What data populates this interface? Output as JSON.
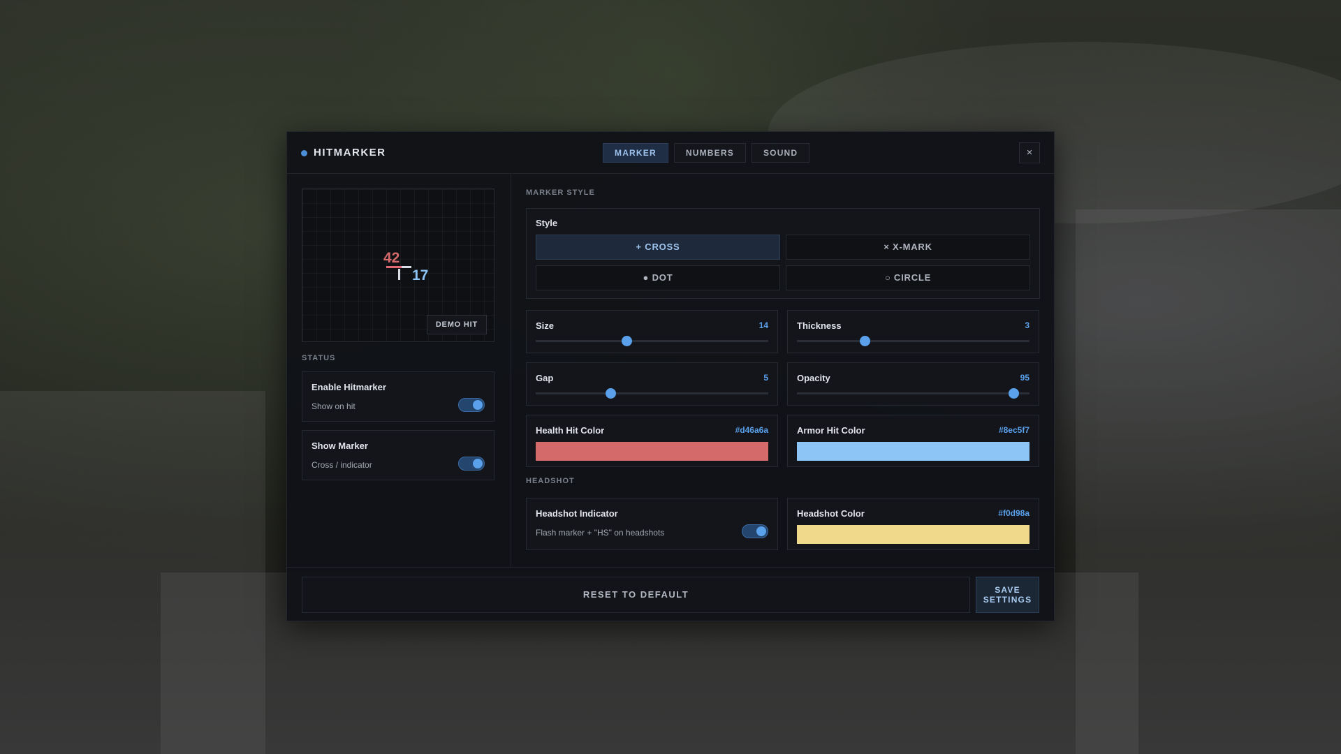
{
  "header": {
    "title": "HITMARKER",
    "tabs": [
      {
        "label": "MARKER",
        "active": true
      },
      {
        "label": "NUMBERS",
        "active": false
      },
      {
        "label": "SOUND",
        "active": false
      }
    ],
    "close_glyph": "×"
  },
  "preview": {
    "health_number": "42",
    "armor_number": "17",
    "demo_label": "DEMO HIT"
  },
  "status": {
    "label": "STATUS",
    "enable_hitmarker": {
      "title": "Enable Hitmarker",
      "subtitle": "Show on hit",
      "enabled": true
    },
    "show_marker": {
      "title": "Show Marker",
      "subtitle": "Cross / indicator",
      "enabled": true
    }
  },
  "marker_style": {
    "section_label": "MARKER STYLE",
    "style_title": "Style",
    "options": [
      {
        "label": "+ CROSS",
        "selected": true
      },
      {
        "label": "× X-MARK",
        "selected": false
      },
      {
        "label": "● DOT",
        "selected": false
      },
      {
        "label": "○ CIRCLE",
        "selected": false
      }
    ]
  },
  "sliders": {
    "size": {
      "label": "Size",
      "value": "14",
      "fraction": 0.39
    },
    "thickness": {
      "label": "Thickness",
      "value": "3",
      "fraction": 0.29
    },
    "gap": {
      "label": "Gap",
      "value": "5",
      "fraction": 0.32
    },
    "opacity": {
      "label": "Opacity",
      "value": "95",
      "fraction": 0.93
    }
  },
  "colors": {
    "health": {
      "label": "Health Hit Color",
      "hex": "#d46a6a"
    },
    "armor": {
      "label": "Armor Hit Color",
      "hex": "#8ec5f7"
    },
    "headshot": {
      "label": "Headshot Color",
      "hex": "#f0d98a"
    }
  },
  "headshot": {
    "section_label": "HEADSHOT",
    "indicator_title": "Headshot Indicator",
    "indicator_subtitle": "Flash marker + \"HS\" on headshots",
    "enabled": true
  },
  "footer": {
    "reset_label": "RESET TO DEFAULT",
    "save_label": "SAVE SETTINGS"
  },
  "theme": {
    "accent": "#5aa0ea"
  }
}
